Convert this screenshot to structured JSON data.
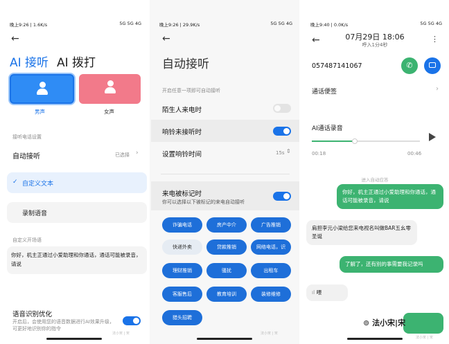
{
  "p1": {
    "status_left": "晚上9:26 | 1.6K/s",
    "status_right": "5G 5G 4G",
    "tab_active": "AI 接听",
    "tab_inactive": "AI 拨打",
    "voice_male": "男声",
    "voice_female": "女声",
    "section_settings": "接听电话设置",
    "auto_answer": "自动接听",
    "auto_answer_value": "已选择",
    "custom_text": "自定义文本",
    "record_voice": "录制语音",
    "section_greeting": "自定义开场语",
    "greeting_text": "你好，机主正通过小爱助理和你通话，通话可能被录音，请说",
    "optimize_title": "语音识别优化",
    "optimize_desc": "开启后，会使用您的语音数据进行AI效果升级，可更好地识别你的指令",
    "watermark": "法小宋 | 宋"
  },
  "p2": {
    "status_left": "晚上9:26 | 29.9K/s",
    "status_right": "5G 5G 4G",
    "title": "自动接听",
    "hint": "开启任意一项即可自动接听",
    "row_stranger": "陌生人来电时",
    "row_missed": "响铃未接听时",
    "row_ring_time": "设置响铃时间",
    "ring_time_value": "15s",
    "row_marked": "来电被标记时",
    "row_marked_desc": "你可以选择以下被标记的来电自动接听",
    "tags": [
      "诈骗电话",
      "房产中介",
      "广告推销",
      "快递外卖",
      "贷款推销",
      "网络电话，识",
      "理财推销",
      "骚扰",
      "出租车",
      "客服售后",
      "教育培训",
      "装修维修",
      "猎头招聘"
    ],
    "watermark": "法小宋 | 宋"
  },
  "p3": {
    "status_left": "晚上9:40 | 0.0K/s",
    "status_right": "5G 5G 4G",
    "date_time": "07月29日  18:06",
    "duration": "呼入1分4秒",
    "phone_number": "057487141067",
    "notes": "通话便签",
    "recording_title": "AI通话录音",
    "time_start": "00:18",
    "time_end": "00:46",
    "progress": 0.4,
    "mode_label": "进入自动应答",
    "msg1": "你好，机主正通过小爱助理和你通话，通话可能被录音，请说",
    "msg2": "肩担李元小梁给您来电视名叫做BAR五幺零圣诞",
    "msg3": "了解了，还有别的事需要我记录吗",
    "msg4": "喂",
    "brand": "法小宋|宋",
    "watermark": "法小宋 | 宋"
  },
  "colors": {
    "accent": "#1a73e8",
    "blue_card": "#2f8cf5",
    "pink_card": "#f27a8a",
    "green": "#3cb371"
  }
}
